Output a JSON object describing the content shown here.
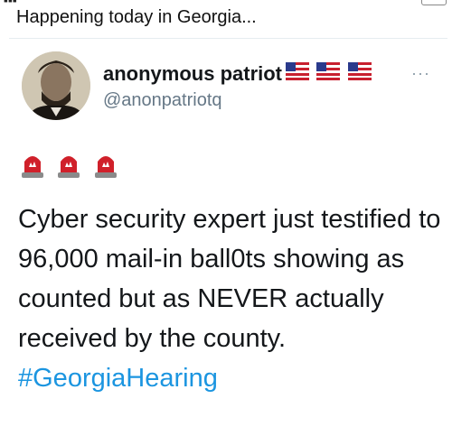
{
  "caption": "Happening today in Georgia...",
  "tweet": {
    "display_name": "anonymous patriot",
    "handle": "@anonpatriotq",
    "more_label": "···",
    "flag_icons": [
      "us-flag-icon",
      "us-flag-icon",
      "us-flag-icon"
    ],
    "emoji_icons": [
      "siren-icon",
      "siren-icon",
      "siren-icon"
    ],
    "text": "Cyber security expert just testified to 96,000 mail-in ball0ts showing as counted but as NEVER actually received by the county.",
    "hashtag": "#GeorgiaHearing"
  },
  "colors": {
    "hashtag": "#1b95e0",
    "handle": "#657786",
    "siren": "#d0202a"
  }
}
